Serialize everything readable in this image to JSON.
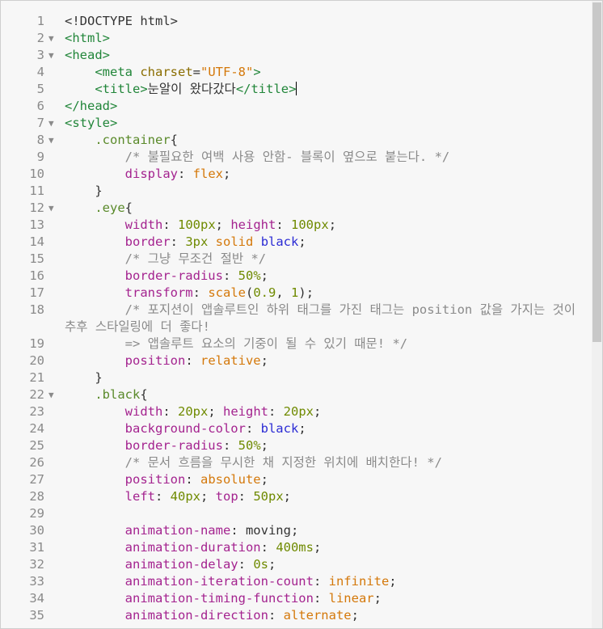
{
  "editor": {
    "lines": [
      {
        "n": "1",
        "fold": "",
        "segs": [
          [
            "plain",
            "&lt;!DOCTYPE html&gt;"
          ]
        ]
      },
      {
        "n": "2",
        "fold": "▼",
        "segs": [
          [
            "tag",
            "<html>"
          ]
        ]
      },
      {
        "n": "3",
        "fold": "▼",
        "segs": [
          [
            "tag",
            "<head>"
          ]
        ]
      },
      {
        "n": "4",
        "fold": "",
        "segs": [
          [
            "plain",
            "    "
          ],
          [
            "tag",
            "<meta "
          ],
          [
            "attr",
            "charset"
          ],
          [
            "plain",
            "="
          ],
          [
            "str",
            "\"UTF-8\""
          ],
          [
            "tag",
            ">"
          ]
        ]
      },
      {
        "n": "5",
        "fold": "",
        "segs": [
          [
            "plain",
            "    "
          ],
          [
            "tag",
            "<title>"
          ],
          [
            "plain",
            "눈알이 왔다갔다"
          ],
          [
            "tag",
            "</title>"
          ]
        ],
        "caret": true
      },
      {
        "n": "6",
        "fold": "",
        "segs": [
          [
            "tag",
            "</head>"
          ]
        ]
      },
      {
        "n": "7",
        "fold": "▼",
        "segs": [
          [
            "tag",
            "<style>"
          ]
        ]
      },
      {
        "n": "8",
        "fold": "▼",
        "segs": [
          [
            "plain",
            "    "
          ],
          [
            "sel",
            ".container"
          ],
          [
            "plain",
            "{"
          ]
        ]
      },
      {
        "n": "9",
        "fold": "",
        "segs": [
          [
            "plain",
            "        "
          ],
          [
            "cm",
            "/* 불필요한 여백 사용 안함- 블록이 옆으로 붙는다. */"
          ]
        ]
      },
      {
        "n": "10",
        "fold": "",
        "segs": [
          [
            "plain",
            "        "
          ],
          [
            "prop",
            "display"
          ],
          [
            "plain",
            ": "
          ],
          [
            "str",
            "flex"
          ],
          [
            "plain",
            ";"
          ]
        ]
      },
      {
        "n": "11",
        "fold": "",
        "segs": [
          [
            "plain",
            "    }"
          ]
        ]
      },
      {
        "n": "12",
        "fold": "▼",
        "segs": [
          [
            "plain",
            "    "
          ],
          [
            "sel",
            ".eye"
          ],
          [
            "plain",
            "{"
          ]
        ]
      },
      {
        "n": "13",
        "fold": "",
        "segs": [
          [
            "plain",
            "        "
          ],
          [
            "prop",
            "width"
          ],
          [
            "plain",
            ": "
          ],
          [
            "val",
            "100px"
          ],
          [
            "plain",
            "; "
          ],
          [
            "prop",
            "height"
          ],
          [
            "plain",
            ": "
          ],
          [
            "val",
            "100px"
          ],
          [
            "plain",
            ";"
          ]
        ]
      },
      {
        "n": "14",
        "fold": "",
        "segs": [
          [
            "plain",
            "        "
          ],
          [
            "prop",
            "border"
          ],
          [
            "plain",
            ": "
          ],
          [
            "val",
            "3px"
          ],
          [
            "plain",
            " "
          ],
          [
            "str",
            "solid"
          ],
          [
            "plain",
            " "
          ],
          [
            "kw",
            "black"
          ],
          [
            "plain",
            ";"
          ]
        ]
      },
      {
        "n": "15",
        "fold": "",
        "segs": [
          [
            "plain",
            "        "
          ],
          [
            "cm",
            "/* 그냥 무조건 절반 */"
          ]
        ]
      },
      {
        "n": "16",
        "fold": "",
        "segs": [
          [
            "plain",
            "        "
          ],
          [
            "prop",
            "border-radius"
          ],
          [
            "plain",
            ": "
          ],
          [
            "val",
            "50%"
          ],
          [
            "plain",
            ";"
          ]
        ]
      },
      {
        "n": "17",
        "fold": "",
        "segs": [
          [
            "plain",
            "        "
          ],
          [
            "prop",
            "transform"
          ],
          [
            "plain",
            ": "
          ],
          [
            "str",
            "scale"
          ],
          [
            "plain",
            "("
          ],
          [
            "val",
            "0.9"
          ],
          [
            "plain",
            ", "
          ],
          [
            "val",
            "1"
          ],
          [
            "plain",
            ");"
          ]
        ]
      },
      {
        "n": "18",
        "fold": "",
        "tall": true,
        "segs": [
          [
            "plain",
            "        "
          ],
          [
            "cm",
            "/* 포지션이 앱솔루트인 하위 태그를 가진 태그는 position 값을 가지는 것이 추후 스타일링에 더 좋다!"
          ]
        ]
      },
      {
        "n": "19",
        "fold": "",
        "segs": [
          [
            "plain",
            "        "
          ],
          [
            "cm",
            "=> 앱솔루트 요소의 기중이 될 수 있기 때문! */"
          ]
        ]
      },
      {
        "n": "20",
        "fold": "",
        "segs": [
          [
            "plain",
            "        "
          ],
          [
            "prop",
            "position"
          ],
          [
            "plain",
            ": "
          ],
          [
            "str",
            "relative"
          ],
          [
            "plain",
            ";"
          ]
        ]
      },
      {
        "n": "21",
        "fold": "",
        "segs": [
          [
            "plain",
            "    }"
          ]
        ]
      },
      {
        "n": "22",
        "fold": "▼",
        "segs": [
          [
            "plain",
            "    "
          ],
          [
            "sel",
            ".black"
          ],
          [
            "plain",
            "{"
          ]
        ]
      },
      {
        "n": "23",
        "fold": "",
        "segs": [
          [
            "plain",
            "        "
          ],
          [
            "prop",
            "width"
          ],
          [
            "plain",
            ": "
          ],
          [
            "val",
            "20px"
          ],
          [
            "plain",
            "; "
          ],
          [
            "prop",
            "height"
          ],
          [
            "plain",
            ": "
          ],
          [
            "val",
            "20px"
          ],
          [
            "plain",
            ";"
          ]
        ]
      },
      {
        "n": "24",
        "fold": "",
        "segs": [
          [
            "plain",
            "        "
          ],
          [
            "prop",
            "background-color"
          ],
          [
            "plain",
            ": "
          ],
          [
            "kw",
            "black"
          ],
          [
            "plain",
            ";"
          ]
        ]
      },
      {
        "n": "25",
        "fold": "",
        "segs": [
          [
            "plain",
            "        "
          ],
          [
            "prop",
            "border-radius"
          ],
          [
            "plain",
            ": "
          ],
          [
            "val",
            "50%"
          ],
          [
            "plain",
            ";"
          ]
        ]
      },
      {
        "n": "26",
        "fold": "",
        "segs": [
          [
            "plain",
            "        "
          ],
          [
            "cm",
            "/* 문서 흐름을 무시한 채 지정한 위치에 배치한다! */"
          ]
        ]
      },
      {
        "n": "27",
        "fold": "",
        "segs": [
          [
            "plain",
            "        "
          ],
          [
            "prop",
            "position"
          ],
          [
            "plain",
            ": "
          ],
          [
            "str",
            "absolute"
          ],
          [
            "plain",
            ";"
          ]
        ]
      },
      {
        "n": "28",
        "fold": "",
        "segs": [
          [
            "plain",
            "        "
          ],
          [
            "prop",
            "left"
          ],
          [
            "plain",
            ": "
          ],
          [
            "val",
            "40px"
          ],
          [
            "plain",
            "; "
          ],
          [
            "prop",
            "top"
          ],
          [
            "plain",
            ": "
          ],
          [
            "val",
            "50px"
          ],
          [
            "plain",
            ";"
          ]
        ]
      },
      {
        "n": "29",
        "fold": "",
        "segs": [
          [
            "plain",
            ""
          ]
        ]
      },
      {
        "n": "30",
        "fold": "",
        "segs": [
          [
            "plain",
            "        "
          ],
          [
            "prop",
            "animation-name"
          ],
          [
            "plain",
            ": moving;"
          ]
        ]
      },
      {
        "n": "31",
        "fold": "",
        "segs": [
          [
            "plain",
            "        "
          ],
          [
            "prop",
            "animation-duration"
          ],
          [
            "plain",
            ": "
          ],
          [
            "val",
            "400ms"
          ],
          [
            "plain",
            ";"
          ]
        ]
      },
      {
        "n": "32",
        "fold": "",
        "segs": [
          [
            "plain",
            "        "
          ],
          [
            "prop",
            "animation-delay"
          ],
          [
            "plain",
            ": "
          ],
          [
            "val",
            "0s"
          ],
          [
            "plain",
            ";"
          ]
        ]
      },
      {
        "n": "33",
        "fold": "",
        "segs": [
          [
            "plain",
            "        "
          ],
          [
            "prop",
            "animation-iteration-count"
          ],
          [
            "plain",
            ": "
          ],
          [
            "str",
            "infinite"
          ],
          [
            "plain",
            ";"
          ]
        ]
      },
      {
        "n": "34",
        "fold": "",
        "segs": [
          [
            "plain",
            "        "
          ],
          [
            "prop",
            "animation-timing-function"
          ],
          [
            "plain",
            ": "
          ],
          [
            "str",
            "linear"
          ],
          [
            "plain",
            ";"
          ]
        ]
      },
      {
        "n": "35",
        "fold": "",
        "segs": [
          [
            "plain",
            "        "
          ],
          [
            "prop",
            "animation-direction"
          ],
          [
            "plain",
            ": "
          ],
          [
            "str",
            "alternate"
          ],
          [
            "plain",
            ";"
          ]
        ]
      }
    ]
  }
}
